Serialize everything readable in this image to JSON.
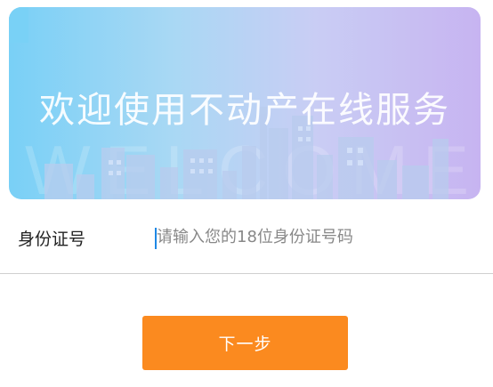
{
  "banner": {
    "title": "欢迎使用不动产在线服务",
    "watermark": "WELCOME"
  },
  "form": {
    "id_label": "身份证号",
    "id_placeholder": "请输入您的18位身份证号码",
    "id_value": ""
  },
  "actions": {
    "next_label": "下一步"
  },
  "colors": {
    "banner_start": "#79d0f6",
    "banner_end": "#c7b4f1",
    "button": "#fb8a1f",
    "cursor": "#1e88e5"
  }
}
